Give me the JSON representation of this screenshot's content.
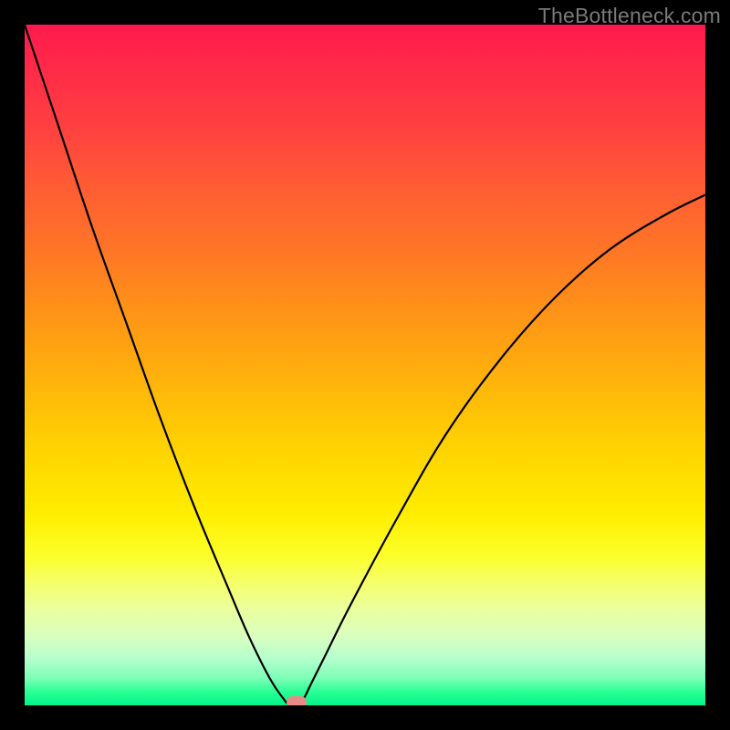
{
  "watermark": "TheBottleneck.com",
  "chart_data": {
    "type": "line",
    "title": "",
    "xlabel": "",
    "ylabel": "",
    "xlim": [
      0,
      100
    ],
    "ylim": [
      0,
      100
    ],
    "background_gradient": {
      "top_color": "#ff1a4d",
      "mid_color": "#ffd800",
      "bottom_color": "#00f589",
      "meaning": "red = high bottleneck, green = low bottleneck"
    },
    "series": [
      {
        "name": "bottleneck-curve",
        "x": [
          0,
          5,
          10,
          15,
          20,
          25,
          30,
          33,
          36,
          38,
          39,
          40,
          41,
          42,
          44,
          48,
          55,
          62,
          70,
          78,
          86,
          94,
          100
        ],
        "values": [
          100,
          85,
          70,
          56,
          42,
          29,
          17,
          10,
          4,
          1,
          0,
          0,
          1,
          3,
          7,
          15,
          28,
          40,
          51,
          60,
          67,
          72,
          75
        ]
      }
    ],
    "marker": {
      "name": "optimal-point",
      "x": 40,
      "y": 0,
      "color": "#e88b87"
    }
  }
}
